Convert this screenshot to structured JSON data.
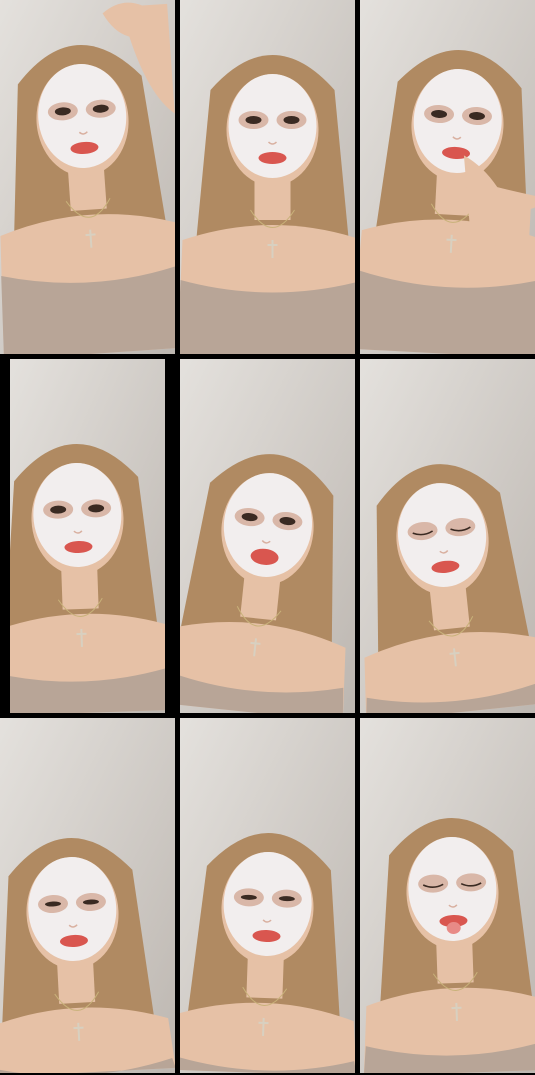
{
  "collage": {
    "rows": 3,
    "columns": 3,
    "panels": [
      {
        "label": "",
        "pose": "hand-in-hair",
        "eyes": "open",
        "mouth": "neutral"
      },
      {
        "label": "",
        "pose": "looking-forward",
        "eyes": "open",
        "mouth": "neutral"
      },
      {
        "label": "",
        "pose": "finger-at-lip",
        "eyes": "open",
        "mouth": "pout"
      },
      {
        "label": "",
        "pose": "looking-forward",
        "eyes": "open",
        "mouth": "neutral"
      },
      {
        "label": "",
        "pose": "head-tilt",
        "eyes": "open",
        "mouth": "talking"
      },
      {
        "label": "",
        "pose": "head-tilt",
        "eyes": "closed",
        "mouth": "neutral"
      },
      {
        "label": "",
        "pose": "looking-down",
        "eyes": "half-closed",
        "mouth": "neutral"
      },
      {
        "label": "",
        "pose": "looking-down",
        "eyes": "half-closed",
        "mouth": "neutral"
      },
      {
        "label": "",
        "pose": "tongue-out",
        "eyes": "closed",
        "mouth": "tongue"
      }
    ]
  },
  "colors": {
    "background": "#000000",
    "wall": "#d8d4cf",
    "hair": "#b08a62",
    "skin": "#e6c1a6",
    "mask": "#f2eeee",
    "lips": "#d9564f",
    "top": "#b8a597"
  }
}
